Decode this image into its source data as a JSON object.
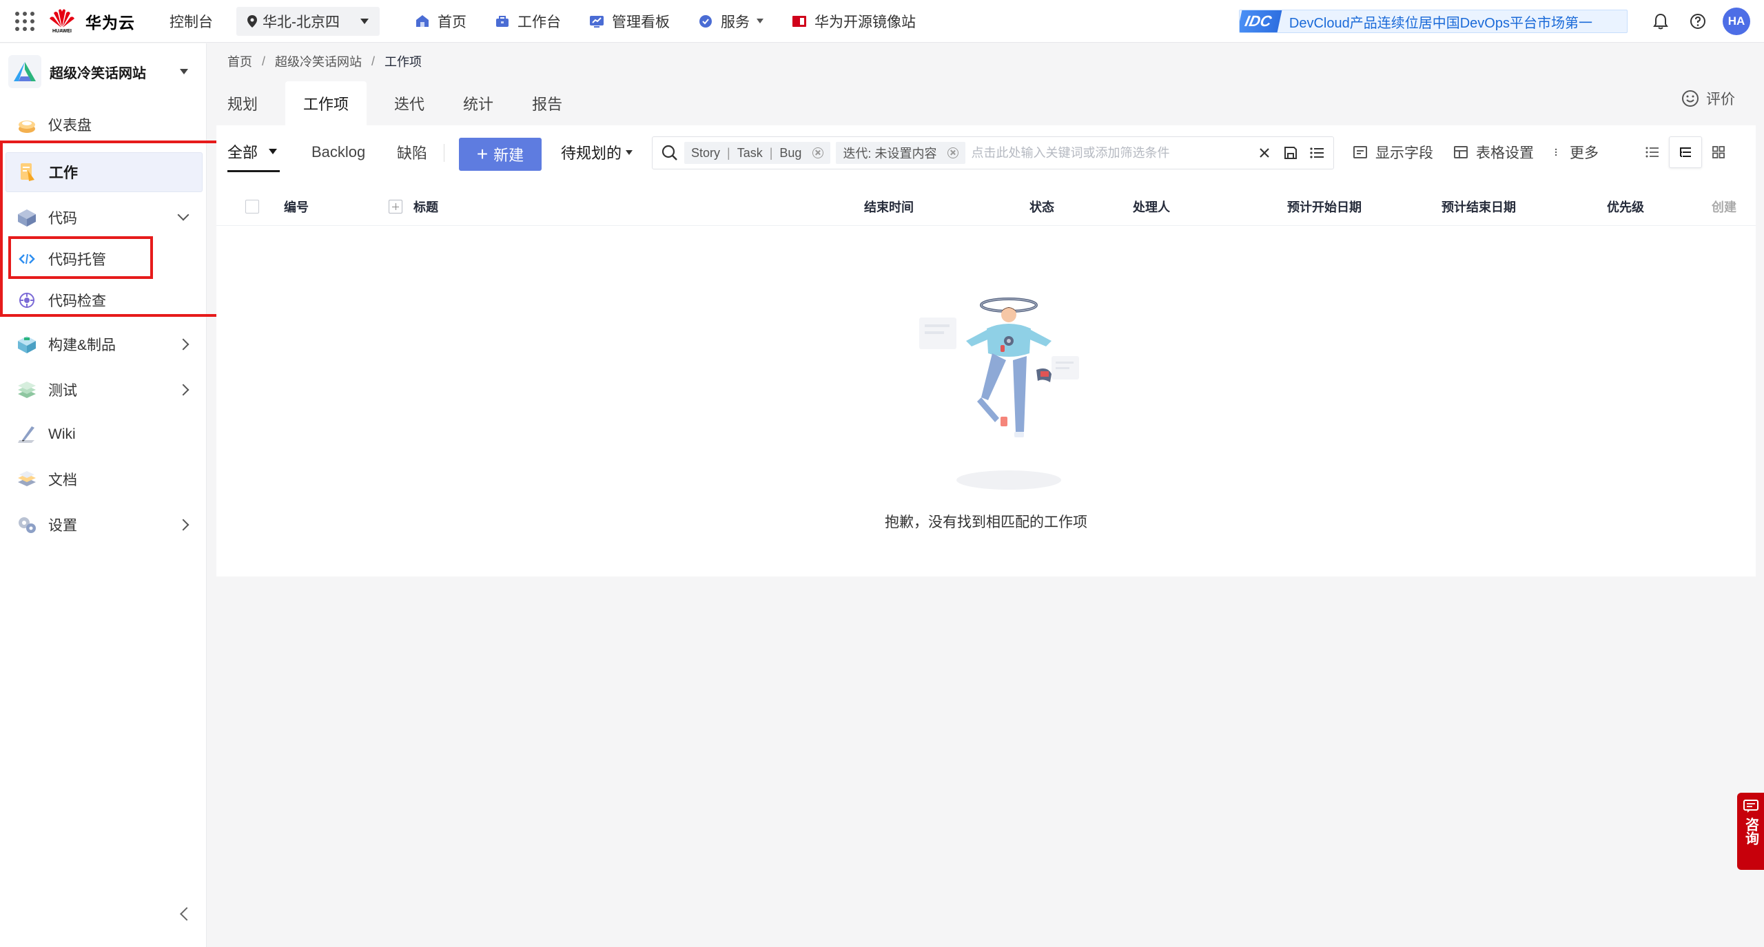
{
  "topbar": {
    "brand": "华为云",
    "brand_sub": "HUAWEI",
    "console": "控制台",
    "region": "华北-北京四",
    "nav": [
      {
        "label": "首页",
        "icon": "home-icon"
      },
      {
        "label": "工作台",
        "icon": "workbench-icon"
      },
      {
        "label": "管理看板",
        "icon": "dashboard-icon"
      },
      {
        "label": "服务",
        "icon": "services-icon"
      },
      {
        "label": "华为开源镜像站",
        "icon": "mirror-icon"
      }
    ],
    "banner_badge": "IDC",
    "banner_text": "DevCloud产品连续位居中国DevOps平台市场第一",
    "avatar": "HA"
  },
  "sidebar": {
    "project_name": "超级冷笑话网站",
    "items": [
      {
        "label": "仪表盘",
        "icon": "dashboard-icon"
      },
      {
        "label": "工作",
        "icon": "work-icon"
      },
      {
        "label": "代码",
        "icon": "code-icon"
      },
      {
        "label": "代码托管",
        "icon": "code-hosting-icon"
      },
      {
        "label": "代码检查",
        "icon": "code-check-icon"
      },
      {
        "label": "构建&制品",
        "icon": "build-icon"
      },
      {
        "label": "测试",
        "icon": "test-icon"
      },
      {
        "label": "Wiki",
        "icon": "wiki-icon"
      },
      {
        "label": "文档",
        "icon": "docs-icon"
      },
      {
        "label": "设置",
        "icon": "settings-icon"
      }
    ]
  },
  "breadcrumb": [
    "首页",
    "超级冷笑话网站",
    "工作项"
  ],
  "tabs": [
    "规划",
    "工作项",
    "迭代",
    "统计",
    "报告"
  ],
  "feedback": "评价",
  "toolbar": {
    "all": "全部",
    "backlog": "Backlog",
    "defects": "缺陷",
    "new": "新建",
    "plan": "待规划的",
    "chip_types": [
      "Story",
      "Task",
      "Bug"
    ],
    "chip_iter": "迭代: 未设置内容",
    "search_placeholder": "点击此处输入关键词或添加筛选条件",
    "show_fields": "显示字段",
    "table_settings": "表格设置",
    "more": "更多"
  },
  "table": {
    "columns": [
      "编号",
      "标题",
      "结束时间",
      "状态",
      "处理人",
      "预计开始日期",
      "预计结束日期",
      "优先级",
      "创建"
    ]
  },
  "empty_text": "抱歉，没有找到相匹配的工作项",
  "consult": "咨询",
  "colors": {
    "primary": "#5e7ce0",
    "highlight": "#e61b1b",
    "brand_red": "#c7000b"
  }
}
